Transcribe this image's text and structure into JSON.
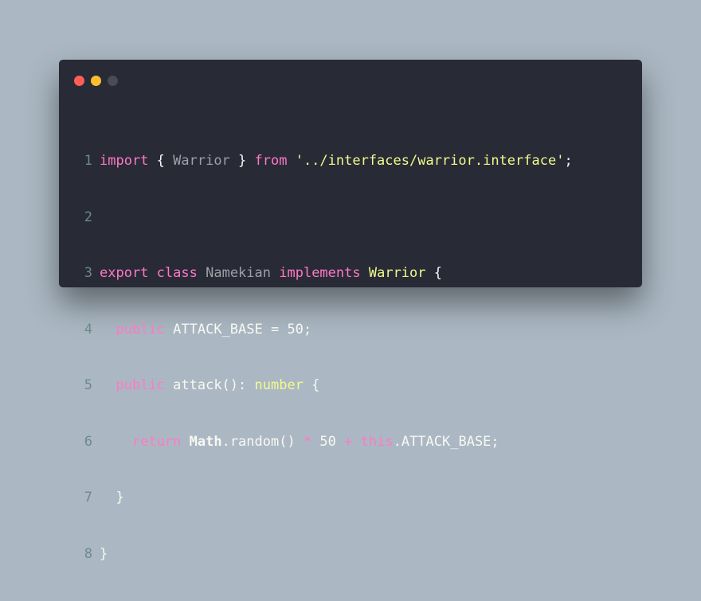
{
  "colors": {
    "background": "#abb8c3",
    "window": "#282a36",
    "close": "#ff5f56",
    "minimize": "#ffbd2e",
    "maximize": "#4a4c55"
  },
  "line_numbers": [
    "1",
    "2",
    "3",
    "4",
    "5",
    "6",
    "7",
    "8"
  ],
  "code": {
    "l1": {
      "import": "import",
      "open": " { ",
      "warrior": "Warrior",
      "close": " } ",
      "from": "from",
      "path": " '../interfaces/warrior.interface'",
      "semi": ";"
    },
    "l3": {
      "export": "export",
      "class": "class",
      "name": "Namekian",
      "implements": "implements",
      "warrior": "Warrior",
      "brace": " {"
    },
    "l4": {
      "public": "public",
      "decl": " ATTACK_BASE = ",
      "num": "50",
      "semi": ";"
    },
    "l5": {
      "public": "public",
      "method": " attack(): ",
      "type": "number",
      "brace": " {"
    },
    "l6": {
      "return": "return",
      "math": "Math",
      "call": ".random() ",
      "mul": "*",
      "num": " 50 ",
      "plus": "+",
      "this": "this",
      "rest": ".ATTACK_BASE;"
    },
    "l7": {
      "brace": "}"
    },
    "l8": {
      "brace": "}"
    }
  }
}
